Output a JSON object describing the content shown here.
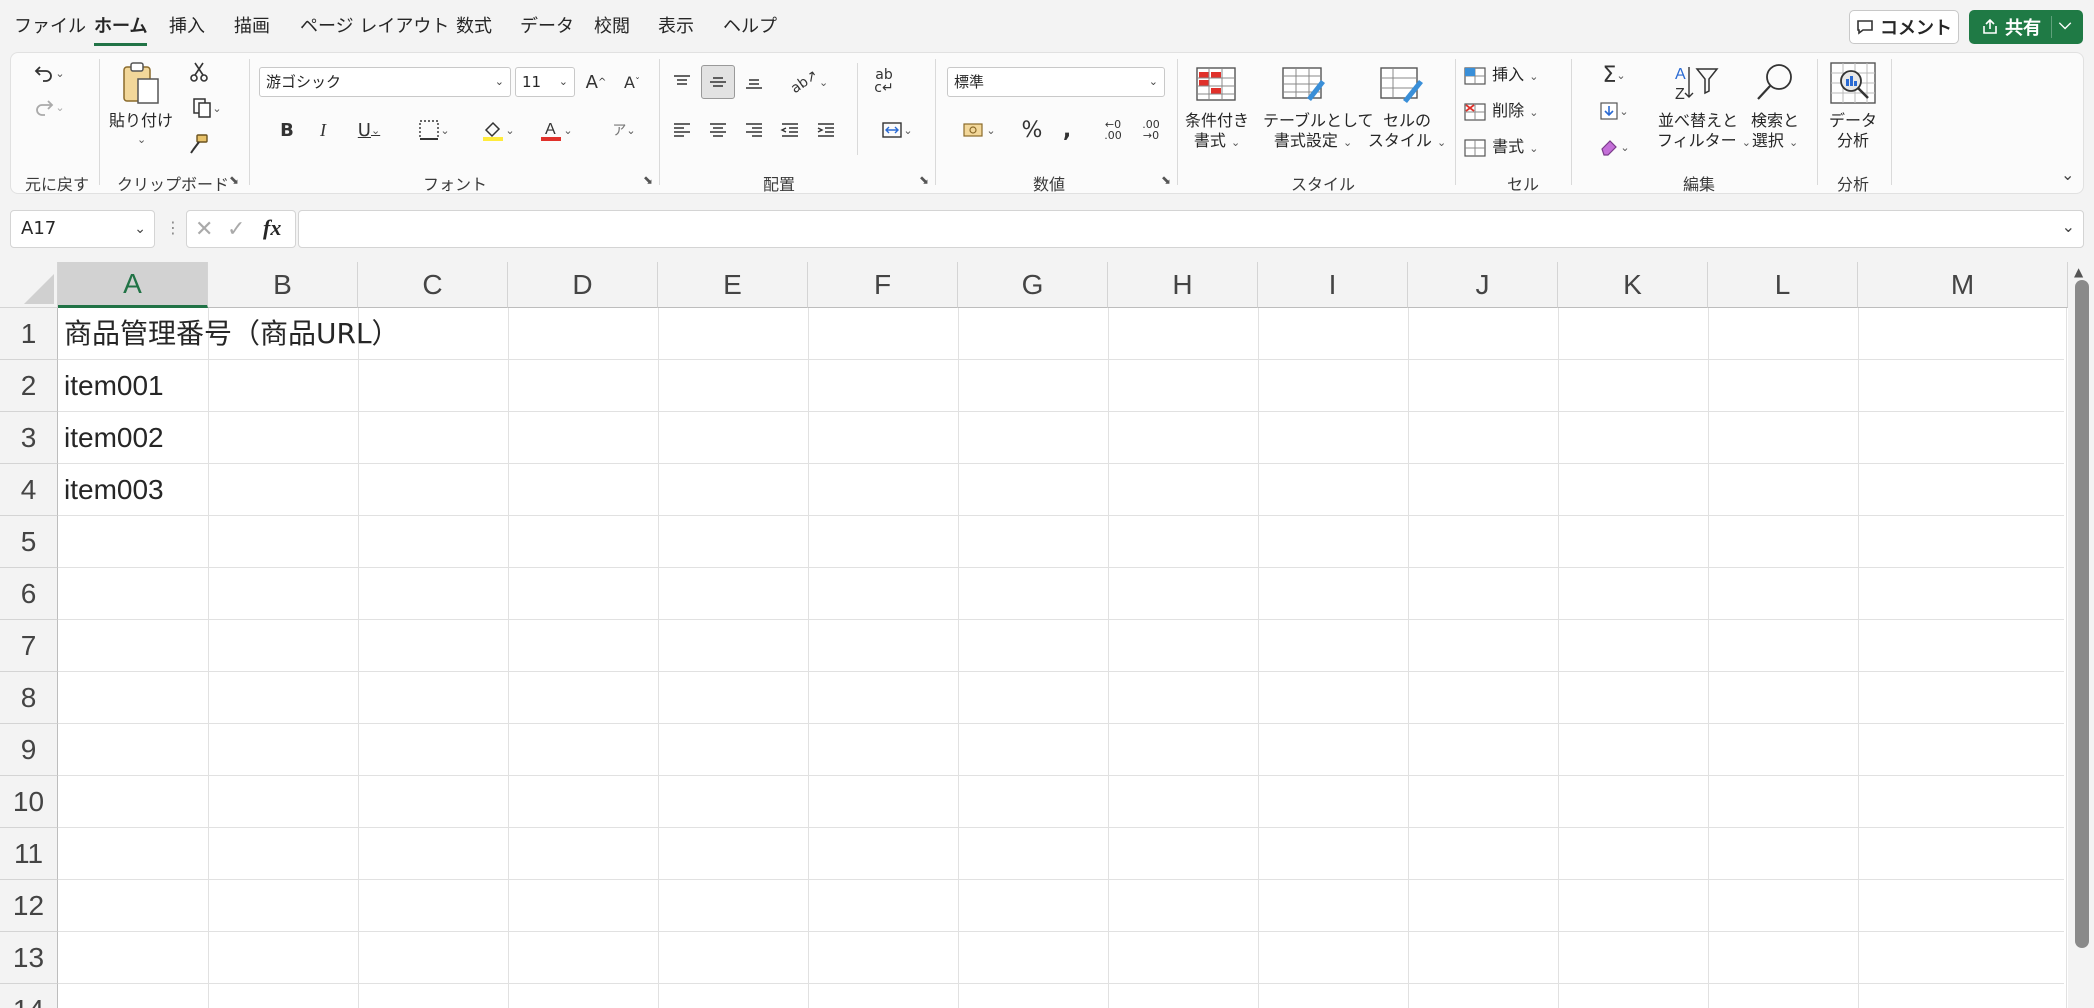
{
  "menu": {
    "tabs": [
      "ファイル",
      "ホーム",
      "挿入",
      "描画",
      "ページ レイアウト",
      "数式",
      "データ",
      "校閲",
      "表示",
      "ヘルプ"
    ],
    "active_tab": "ホーム",
    "comment_label": "コメント",
    "share_label": "共有"
  },
  "ribbon": {
    "undo_group": "元に戻す",
    "clipboard": {
      "label": "クリップボード",
      "paste": "貼り付け"
    },
    "font": {
      "label": "フォント",
      "family": "游ゴシック",
      "size": "11"
    },
    "alignment": {
      "label": "配置"
    },
    "number": {
      "label": "数値",
      "format": "標準"
    },
    "styles": {
      "label": "スタイル",
      "conditional_1": "条件付き",
      "conditional_2": "書式",
      "table_1": "テーブルとして",
      "table_2": "書式設定",
      "cell_1": "セルの",
      "cell_2": "スタイル"
    },
    "cells": {
      "label": "セル",
      "insert": "挿入",
      "delete": "削除",
      "format": "書式"
    },
    "editing": {
      "label": "編集",
      "sort_1": "並べ替えと",
      "sort_2": "フィルター",
      "find_1": "検索と",
      "find_2": "選択"
    },
    "analysis": {
      "label": "分析",
      "data_1": "データ",
      "data_2": "分析"
    }
  },
  "formula_bar": {
    "name_box": "A17",
    "fx": "fx",
    "content": ""
  },
  "sheet": {
    "columns": [
      "A",
      "B",
      "C",
      "D",
      "E",
      "F",
      "G",
      "H",
      "I",
      "J",
      "K",
      "L",
      "M"
    ],
    "selected_column": "A",
    "rows": [
      "1",
      "2",
      "3",
      "4",
      "5",
      "6",
      "7",
      "8",
      "9",
      "10",
      "11",
      "12",
      "13",
      "14"
    ],
    "cells": {
      "A1": "商品管理番号（商品URL）",
      "A2": "item001",
      "A3": "item002",
      "A4": "item003"
    }
  }
}
